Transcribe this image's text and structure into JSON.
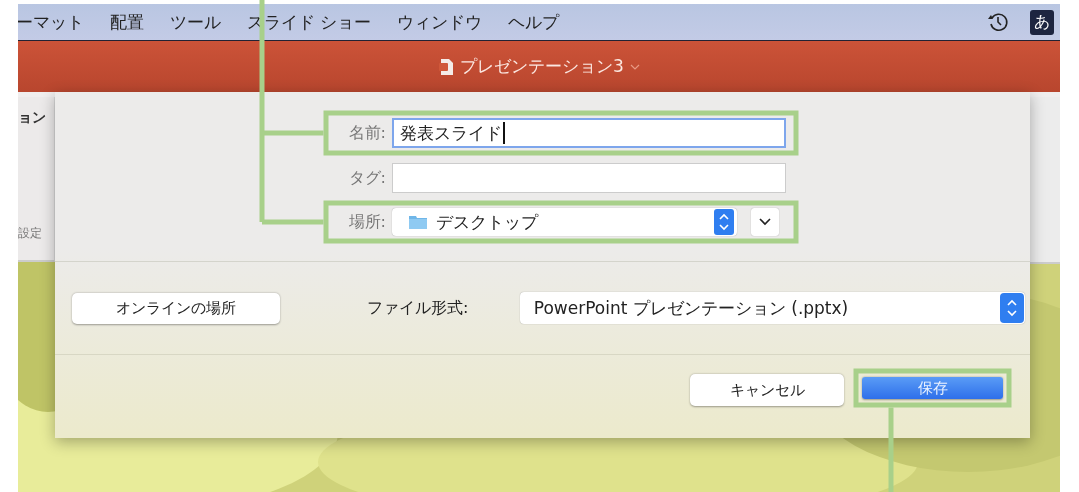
{
  "menu_bar": {
    "items": [
      "ーマット",
      "配置",
      "ツール",
      "スライド ショー",
      "ウィンドウ",
      "ヘルプ"
    ],
    "input_method": "あ"
  },
  "title_bar": {
    "title": "プレゼンテーション3"
  },
  "ribbon": {
    "items": [
      "ョン",
      "設定"
    ]
  },
  "dialog": {
    "name": {
      "label": "名前:",
      "value": "発表スライド",
      "focused": true,
      "highlighted": true
    },
    "tags": {
      "label": "タグ:",
      "highlighted": false
    },
    "location": {
      "label": "場所:",
      "value": "デスクトップ",
      "highlighted": true
    },
    "online_button": {
      "label": "オンラインの場所"
    },
    "format": {
      "label": "ファイル形式:",
      "value": "PowerPoint プレゼンテーション (.pptx)"
    },
    "buttons": [
      {
        "label": "キャンセル",
        "kind": "normal",
        "highlighted": false
      },
      {
        "label": "保存",
        "kind": "default",
        "highlighted": true
      }
    ]
  }
}
